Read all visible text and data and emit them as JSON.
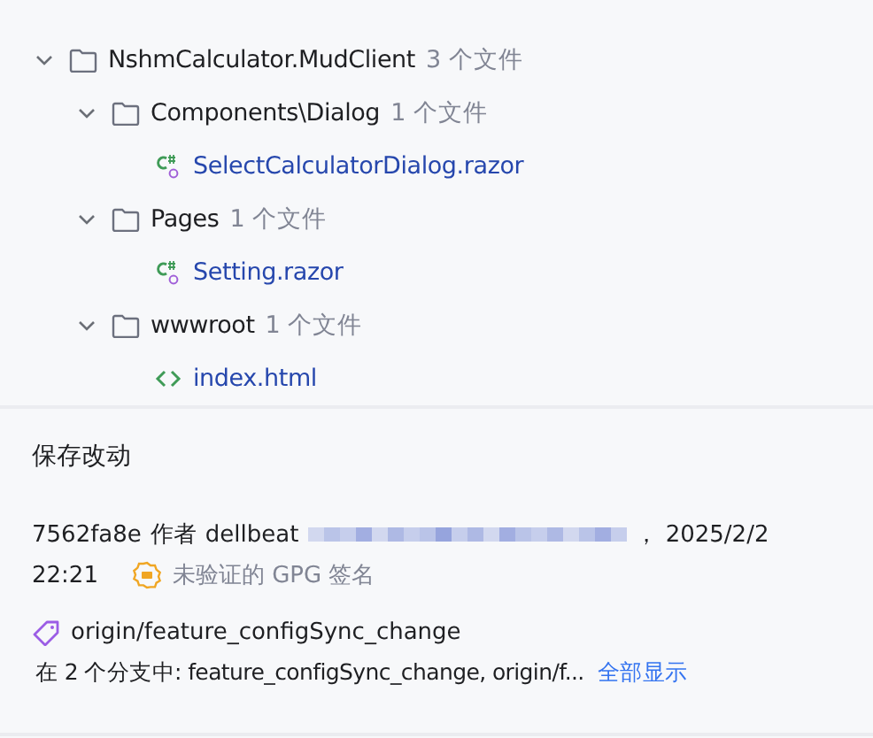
{
  "tree": [
    {
      "kind": "folder",
      "name": "NshmCalculator.MudClient",
      "count": "3 个文件",
      "expanded": true,
      "children": [
        {
          "kind": "folder",
          "name": "Components\\Dialog",
          "count": "1 个文件",
          "expanded": true,
          "children": [
            {
              "kind": "csharp",
              "name": "SelectCalculatorDialog.razor"
            }
          ]
        },
        {
          "kind": "folder",
          "name": "Pages",
          "count": "1 个文件",
          "expanded": true,
          "children": [
            {
              "kind": "csharp",
              "name": "Setting.razor"
            }
          ]
        },
        {
          "kind": "folder",
          "name": "wwwroot",
          "count": "1 个文件",
          "expanded": true,
          "children": [
            {
              "kind": "html",
              "name": "index.html"
            }
          ]
        }
      ]
    }
  ],
  "commit": {
    "message": "保存改动",
    "hash": "7562fa8e",
    "author_label": "作者",
    "author": "dellbeat",
    "date_sep": "，",
    "date": "2025/2/2",
    "time": "22:21",
    "signature": "未验证的 GPG 签名",
    "tag": "origin/feature_configSync_change",
    "branches": "在 2 个分支中: feature_configSync_change, origin/f...",
    "show_all": "全部显示"
  }
}
